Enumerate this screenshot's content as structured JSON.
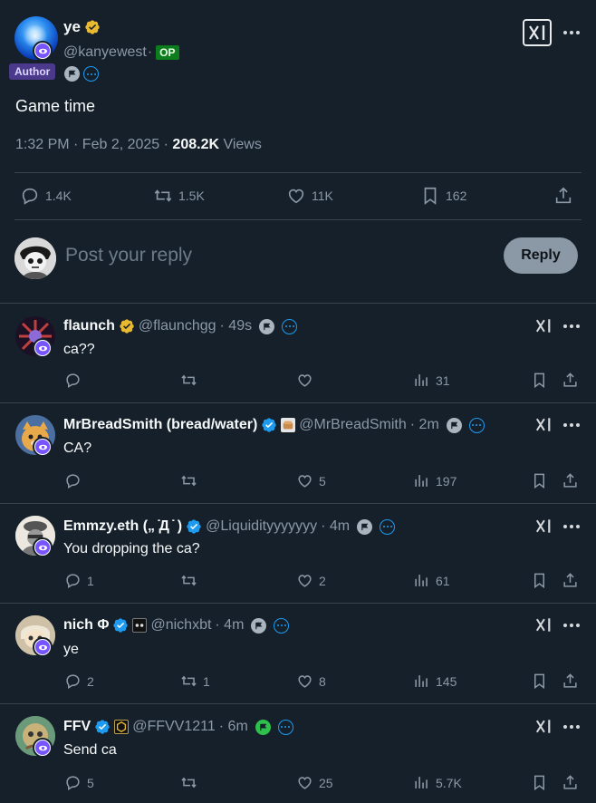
{
  "post": {
    "author_name": "ye",
    "author_handle": "@kanyewest",
    "op_label": "OP",
    "author_tag": "Author",
    "text": "Game time",
    "time": "1:32 PM · Feb 2, 2025 · ",
    "views_count": "208.2K",
    "views_label": "Views",
    "replies": "1.4K",
    "reposts": "1.5K",
    "likes": "11K",
    "bookmarks": "162"
  },
  "reply_box": {
    "placeholder": "Post your reply",
    "button_label": "Reply"
  },
  "comments": [
    {
      "name": "flaunch",
      "handle": "@flaunchgg",
      "time": "· 49s",
      "text": "ca??",
      "replies": "",
      "reposts": "",
      "likes": "",
      "views": "31"
    },
    {
      "name": "MrBreadSmith (bread/water)",
      "handle": "@MrBreadSmith",
      "time": "· 2m",
      "text": "CA?",
      "replies": "",
      "reposts": "",
      "likes": "5",
      "views": "197"
    },
    {
      "name": "Emmzy.eth („ ̇Д ̇ )",
      "handle": "@Liquidityyyyyyy",
      "time": "· 4m",
      "text": "You dropping the ca?",
      "replies": "1",
      "reposts": "",
      "likes": "2",
      "views": "61"
    },
    {
      "name": "nich Φ",
      "handle": "@nichxbt",
      "time": "· 4m",
      "text": "ye",
      "replies": "2",
      "reposts": "1",
      "likes": "8",
      "views": "145"
    },
    {
      "name": "FFV",
      "handle": "@FFVV1211",
      "time": "· 6m",
      "text": "Send ca",
      "replies": "5",
      "reposts": "",
      "likes": "25",
      "views": "5.7K"
    }
  ],
  "colors": {
    "background": "#15202b",
    "accent": "#1d9bf0",
    "gold_verified": "#e8b931",
    "muted": "#8b98a5"
  }
}
